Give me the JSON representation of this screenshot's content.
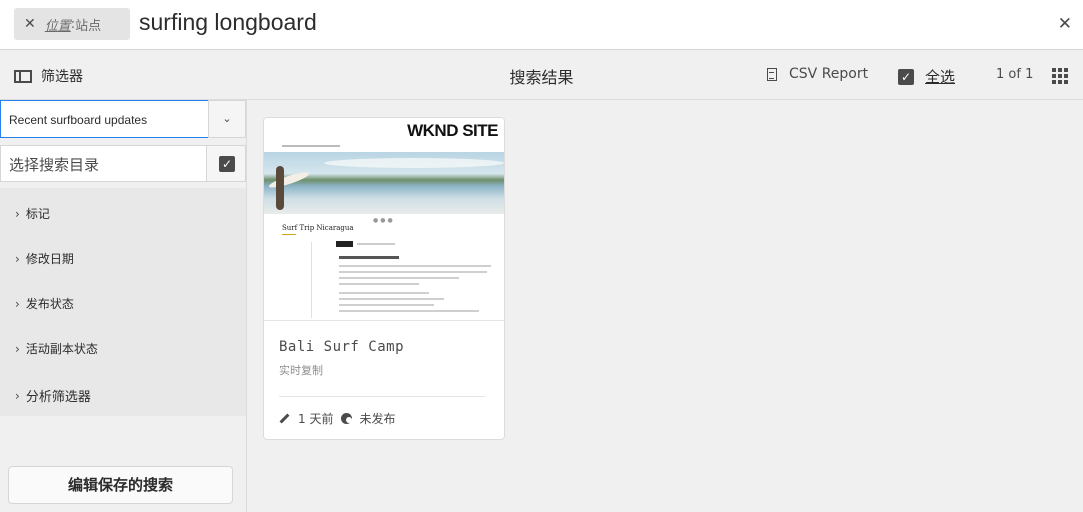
{
  "search": {
    "tag_close": "✕",
    "tag_key": "位置",
    "tag_sep": ":",
    "tag_value": "站点",
    "query": "surfing longboard",
    "clear_icon": "✕"
  },
  "toolbar": {
    "filters_label": "筛选器",
    "title": "搜索结果",
    "csv_label": "CSV Report",
    "select_all_label": "全选",
    "count": "1 of 1"
  },
  "rail": {
    "saved_search": "Recent surfboard updates",
    "dropdown_icon": "⌄",
    "path_placeholder": "选择搜索目录",
    "facets": [
      "标记",
      "修改日期",
      "发布状态",
      "活动副本状态",
      "分析筛选器"
    ],
    "edit_button": "编辑保存的搜索"
  },
  "card": {
    "brand": "WKND SITE",
    "thumb_heading": "Surf Trip Nicaragua",
    "title": "Bali Surf Camp",
    "subtitle": "实时复制",
    "modified": "1 天前",
    "publish_status": "未发布"
  },
  "colors": {
    "accent": "#2680eb",
    "icon": "#4b4b4b",
    "background": "#f0f0f0"
  },
  "icons": [
    "close-icon",
    "left-rail-icon",
    "csv-report-icon",
    "select-all-checkbox-icon",
    "grid-view-icon",
    "chevron-down-icon",
    "checkmark-icon",
    "chevron-right-icon",
    "edit-icon",
    "globe-icon"
  ]
}
